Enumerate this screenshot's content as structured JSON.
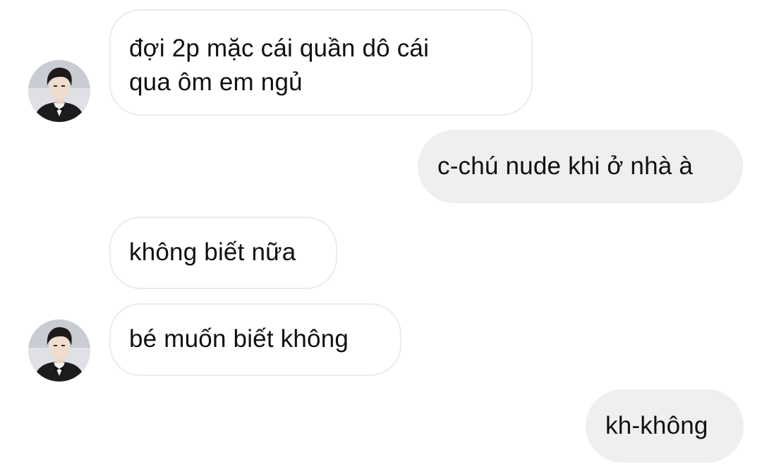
{
  "conversation": {
    "messages": [
      {
        "sender": "contact",
        "lines": [
          "đợi 2p mặc cái quần dô cái",
          "qua ôm em ngủ"
        ]
      },
      {
        "sender": "me",
        "lines": [
          "c-chú nude khi ở nhà à"
        ]
      },
      {
        "sender": "contact",
        "lines": [
          "không biết nữa"
        ]
      },
      {
        "sender": "contact",
        "lines": [
          "bé muốn biết không"
        ]
      },
      {
        "sender": "me",
        "lines": [
          "kh-không"
        ]
      }
    ]
  },
  "theme": {
    "background": "#ffffff",
    "incoming_bubble_bg": "#ffffff",
    "incoming_bubble_border": "#ebebeb",
    "outgoing_bubble_bg": "#efefef",
    "text_color": "#111111"
  },
  "icons": {
    "contact_avatar": "avatar-photo-icon"
  }
}
